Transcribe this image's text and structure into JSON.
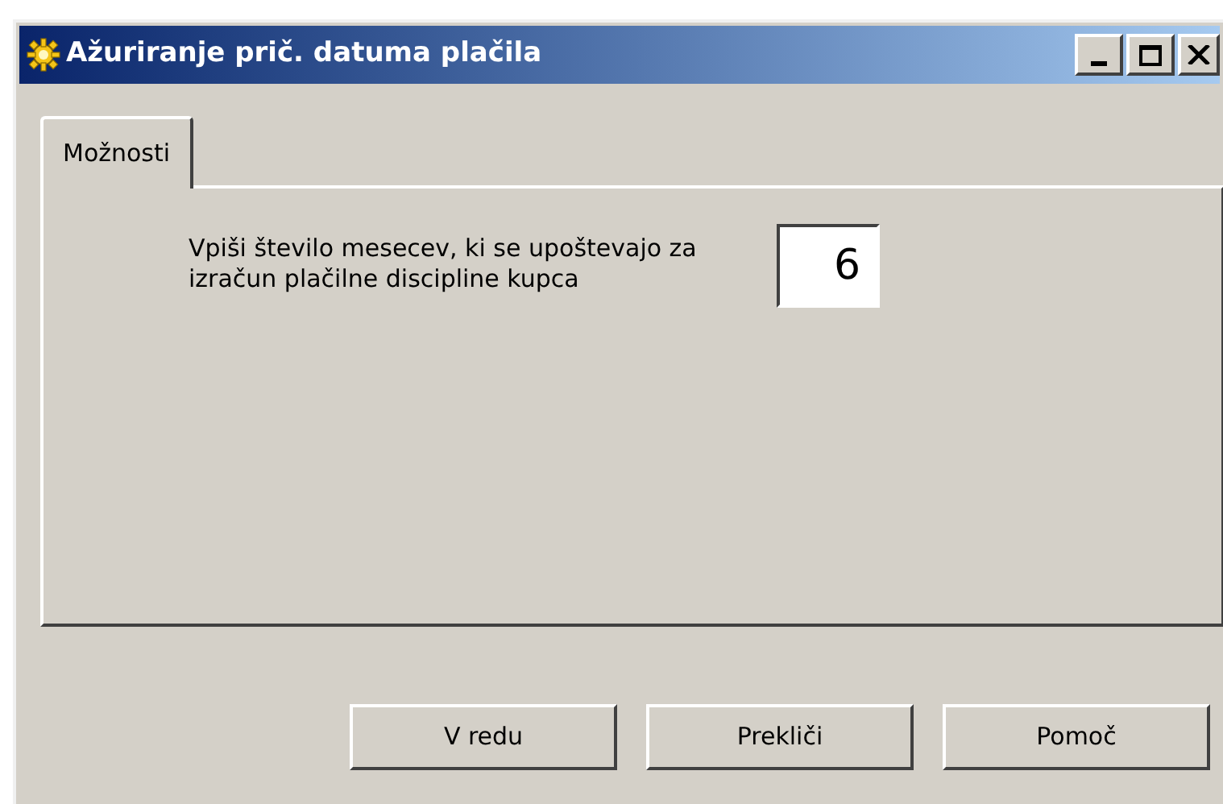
{
  "window": {
    "title": "Ažuriranje prič. datuma plačila"
  },
  "tabs": [
    {
      "label": "Možnosti",
      "selected": true
    }
  ],
  "panel": {
    "prompt": "Vpiši število mesecev, ki se upoštevajo za izračun plačilne discipline kupca",
    "months_field": {
      "value": "6"
    }
  },
  "buttons": [
    {
      "label": "V redu"
    },
    {
      "label": "Prekliči"
    },
    {
      "label": "Pomoč"
    }
  ]
}
